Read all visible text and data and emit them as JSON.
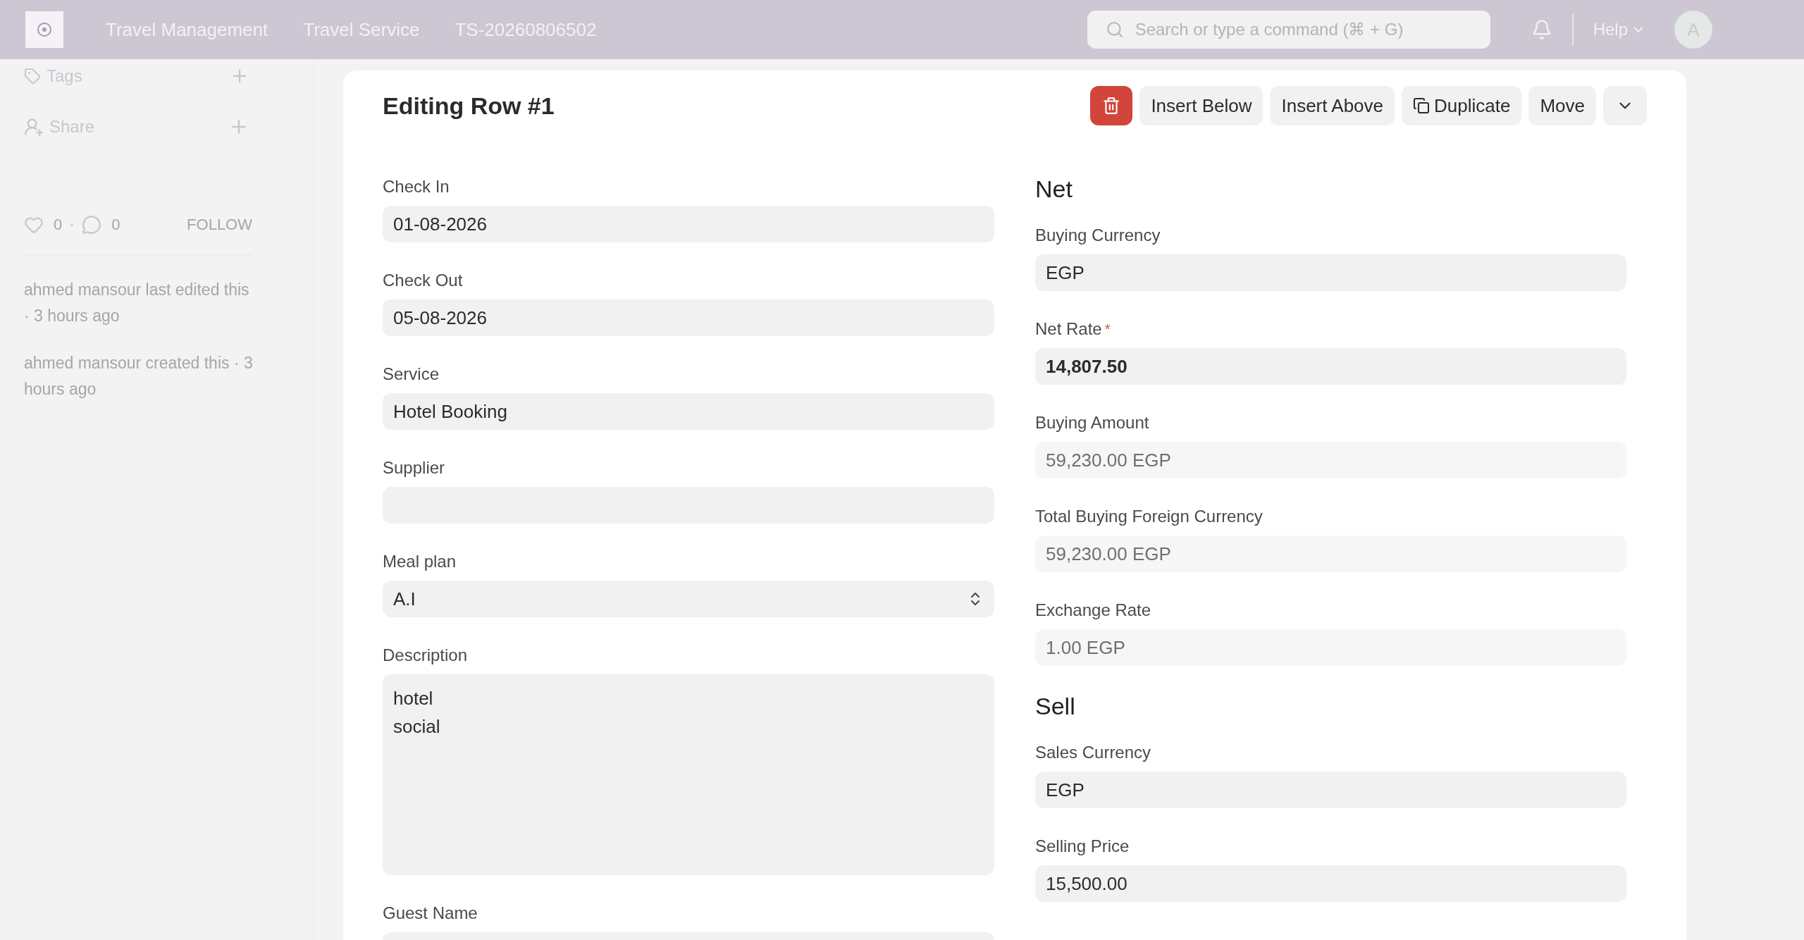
{
  "header": {
    "breadcrumbs": [
      "Travel Management",
      "Travel Service",
      "TS-20260806502"
    ],
    "search": {
      "placeholder": "Search or type a command (⌘ + G)"
    },
    "help": "Help",
    "avatar": "A"
  },
  "sidebar": {
    "tags": "Tags",
    "share": "Share",
    "likes": "0",
    "comments": "0",
    "follow": "FOLLOW",
    "activity": [
      "ahmed mansour last edited this · 3 hours ago",
      "ahmed mansour created this · 3 hours ago"
    ]
  },
  "dialog": {
    "title": "Editing Row #1",
    "actions": [
      {
        "kind": "delete"
      },
      {
        "kind": "text",
        "label": "Insert Below"
      },
      {
        "kind": "text",
        "label": "Insert Above"
      },
      {
        "kind": "duplicate",
        "label": "Duplicate"
      },
      {
        "kind": "text",
        "label": "Move"
      },
      {
        "kind": "more"
      }
    ],
    "left_fields": [
      {
        "kind": "input",
        "label": "Check In",
        "value": "01-08-2026",
        "disabled": false
      },
      {
        "kind": "input",
        "label": "Check Out",
        "value": "05-08-2026",
        "disabled": false
      },
      {
        "kind": "input",
        "label": "Service",
        "value": "Hotel Booking",
        "disabled": false
      },
      {
        "kind": "input",
        "label": "Supplier"
      },
      {
        "kind": "select",
        "label": "Meal plan",
        "value": "A.I",
        "disabled": false
      },
      {
        "kind": "textarea",
        "label": "Description",
        "value": "hotel\nsocial",
        "disabled": false
      },
      {
        "kind": "input",
        "label": "Guest Name"
      }
    ],
    "right_fields": [
      {
        "kind": "heading",
        "label": "Net"
      },
      {
        "kind": "input",
        "label": "Buying Currency",
        "value": "EGP",
        "disabled": false
      },
      {
        "kind": "input",
        "label": "Net Rate",
        "value": "14,807.50",
        "required_mark": "*",
        "disabled": false,
        "bold": true
      },
      {
        "kind": "input",
        "label": "Buying Amount",
        "value": "59,230.00 EGP",
        "disabled": true
      },
      {
        "kind": "input",
        "label": "Total Buying Foreign Currency",
        "value": "59,230.00 EGP",
        "disabled": true
      },
      {
        "kind": "input",
        "label": "Exchange Rate",
        "value": "1.00 EGP",
        "disabled": true
      },
      {
        "kind": "heading",
        "label": "Sell"
      },
      {
        "kind": "input",
        "label": "Sales Currency",
        "value": "EGP",
        "disabled": false
      },
      {
        "kind": "input",
        "label": "Selling Price",
        "value": "15,500.00",
        "disabled": false
      }
    ]
  }
}
